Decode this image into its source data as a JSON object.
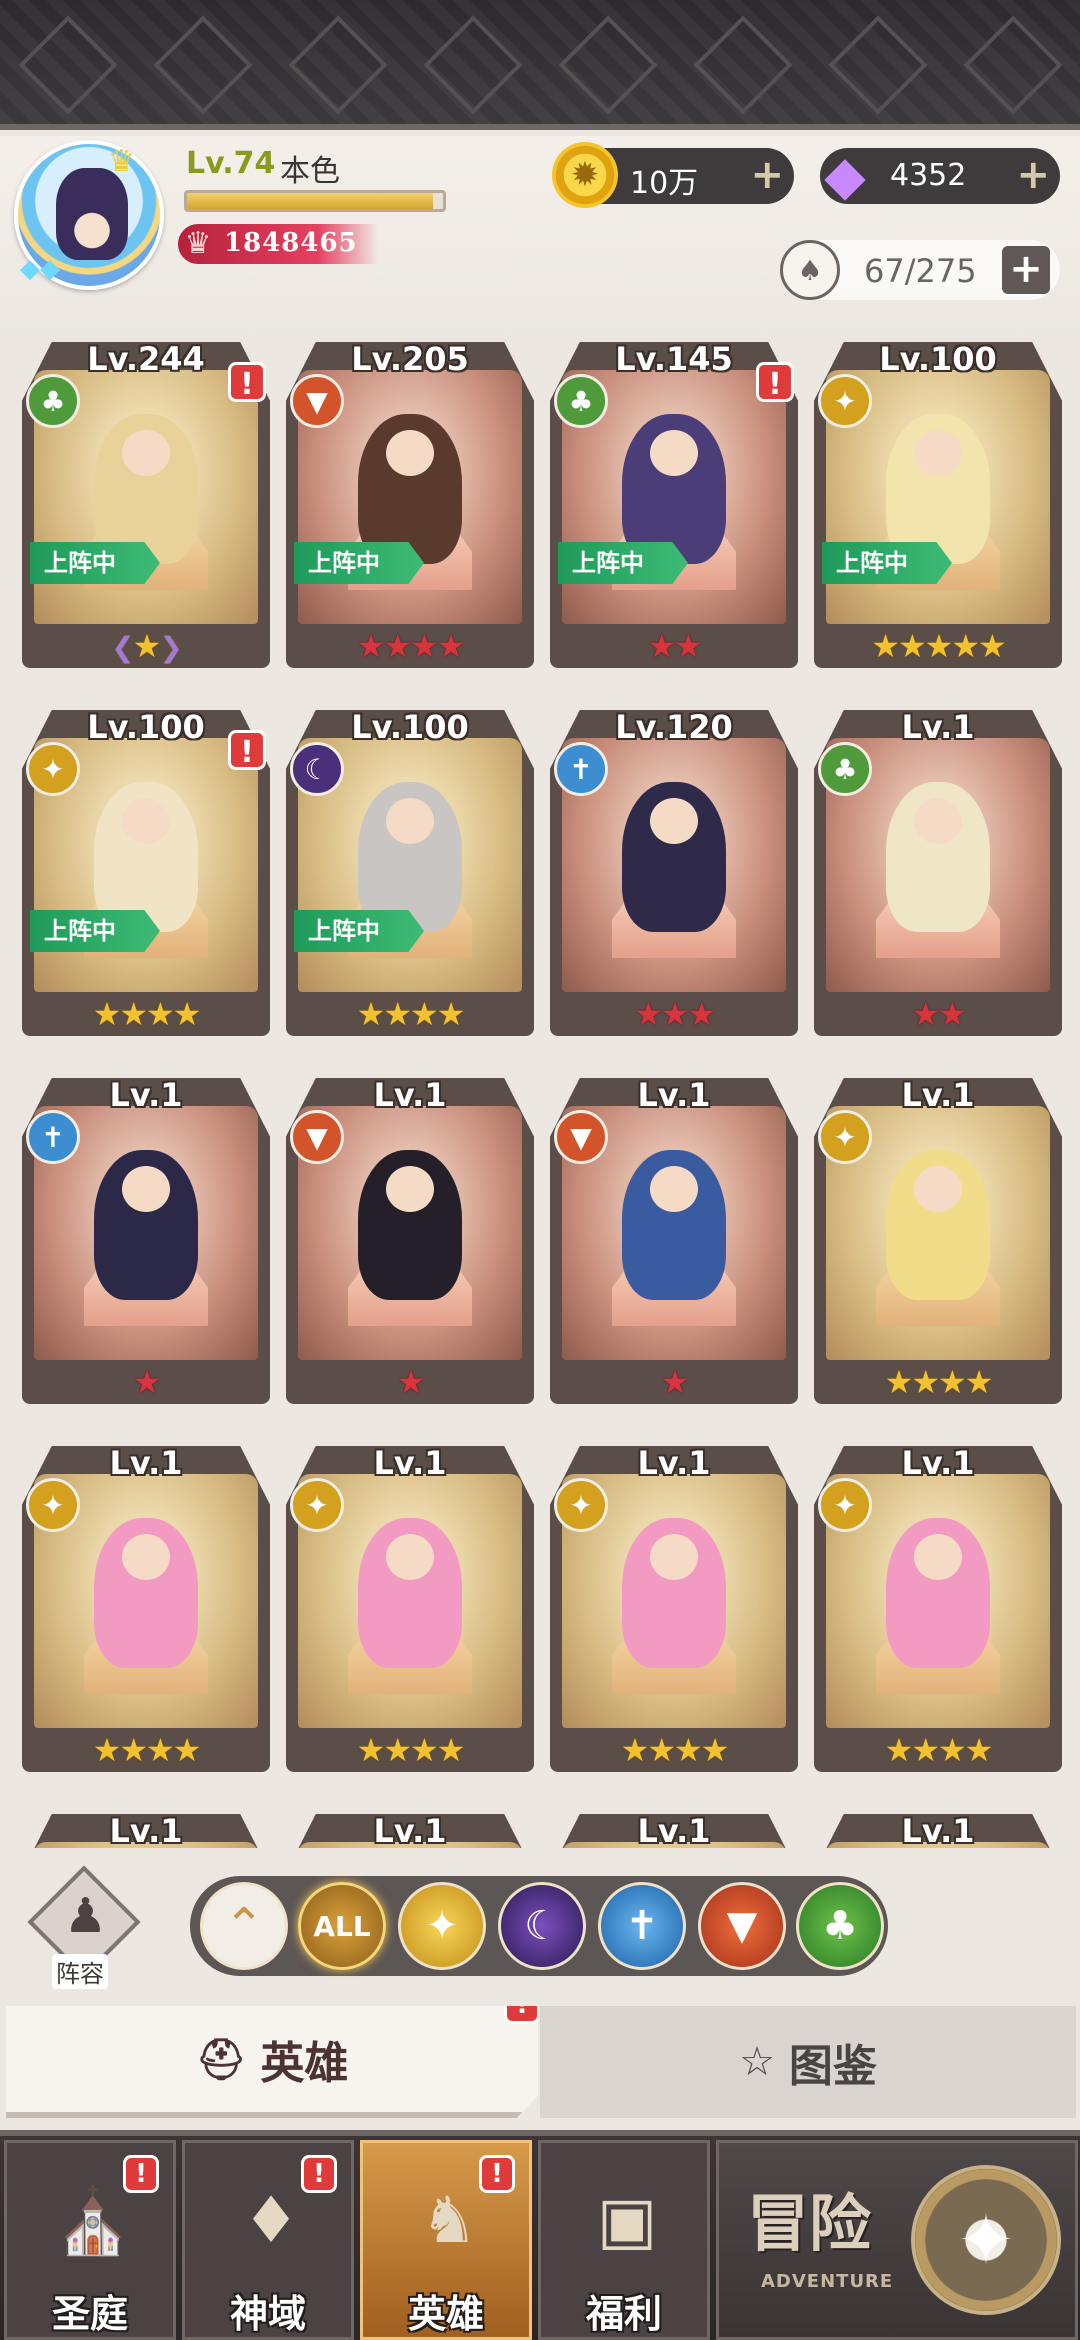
{
  "header": {
    "level": "Lv.74",
    "name": "本色",
    "exp_progress": 0.96,
    "power": "1848465",
    "gold": "10万",
    "diamonds": "4352",
    "hero_capacity": "67/275"
  },
  "heroes": [
    {
      "level": "Lv.244",
      "faction": "nature",
      "alert": true,
      "deployed": true,
      "stars": 1,
      "star_color": "gold",
      "awakened": true
    },
    {
      "level": "Lv.205",
      "faction": "fire",
      "alert": false,
      "deployed": true,
      "stars": 4,
      "star_color": "red"
    },
    {
      "level": "Lv.145",
      "faction": "nature",
      "alert": true,
      "deployed": true,
      "stars": 2,
      "star_color": "red"
    },
    {
      "level": "Lv.100",
      "faction": "light",
      "alert": false,
      "deployed": true,
      "stars": 5,
      "star_color": "gold"
    },
    {
      "level": "Lv.100",
      "faction": "light",
      "alert": true,
      "deployed": true,
      "stars": 4,
      "star_color": "gold"
    },
    {
      "level": "Lv.100",
      "faction": "dark",
      "alert": false,
      "deployed": true,
      "stars": 4,
      "star_color": "gold"
    },
    {
      "level": "Lv.120",
      "faction": "ice",
      "alert": false,
      "deployed": false,
      "stars": 3,
      "star_color": "red"
    },
    {
      "level": "Lv.1",
      "faction": "nature",
      "alert": false,
      "deployed": false,
      "stars": 2,
      "star_color": "red"
    },
    {
      "level": "Lv.1",
      "faction": "ice",
      "alert": false,
      "deployed": false,
      "stars": 1,
      "star_color": "red"
    },
    {
      "level": "Lv.1",
      "faction": "fire",
      "alert": false,
      "deployed": false,
      "stars": 1,
      "star_color": "red"
    },
    {
      "level": "Lv.1",
      "faction": "fire",
      "alert": false,
      "deployed": false,
      "stars": 1,
      "star_color": "red"
    },
    {
      "level": "Lv.1",
      "faction": "light",
      "alert": false,
      "deployed": false,
      "stars": 4,
      "star_color": "gold"
    },
    {
      "level": "Lv.1",
      "faction": "light",
      "alert": false,
      "deployed": false,
      "stars": 4,
      "star_color": "gold"
    },
    {
      "level": "Lv.1",
      "faction": "light",
      "alert": false,
      "deployed": false,
      "stars": 4,
      "star_color": "gold"
    },
    {
      "level": "Lv.1",
      "faction": "light",
      "alert": false,
      "deployed": false,
      "stars": 4,
      "star_color": "gold"
    },
    {
      "level": "Lv.1",
      "faction": "light",
      "alert": false,
      "deployed": false,
      "stars": 4,
      "star_color": "gold"
    },
    {
      "level": "Lv.1",
      "faction": "",
      "alert": false,
      "deployed": false,
      "stars": 0,
      "star_color": "gold"
    },
    {
      "level": "Lv.1",
      "faction": "",
      "alert": false,
      "deployed": false,
      "stars": 0,
      "star_color": "gold"
    },
    {
      "level": "Lv.1",
      "faction": "",
      "alert": false,
      "deployed": false,
      "stars": 0,
      "star_color": "gold"
    },
    {
      "level": "Lv.1",
      "faction": "",
      "alert": false,
      "deployed": false,
      "stars": 0,
      "star_color": "gold"
    }
  ],
  "deployed_label": "上阵中",
  "lineup_label": "阵容",
  "filters": {
    "all_label": "ALL",
    "icons": [
      "collapse-up-icon",
      "all-filter",
      "light-faction-icon",
      "dark-faction-icon",
      "ice-faction-icon",
      "fire-faction-icon",
      "nature-faction-icon"
    ]
  },
  "subtabs": {
    "heroes_label": "英雄",
    "codex_label": "图鉴"
  },
  "nav": {
    "items": [
      {
        "label": "圣庭",
        "badge": "!"
      },
      {
        "label": "神域",
        "badge": "!"
      },
      {
        "label": "英雄",
        "badge": "!"
      },
      {
        "label": "福利",
        "badge": ""
      }
    ],
    "adventure_title": "冒险",
    "adventure_sub": "ADVENTURE"
  },
  "badge_text": "!",
  "colors": {
    "deploy_green": "#2aa865",
    "alert_red": "#e03b3b",
    "star_gold": "#f2c230",
    "star_red": "#d9333e"
  }
}
